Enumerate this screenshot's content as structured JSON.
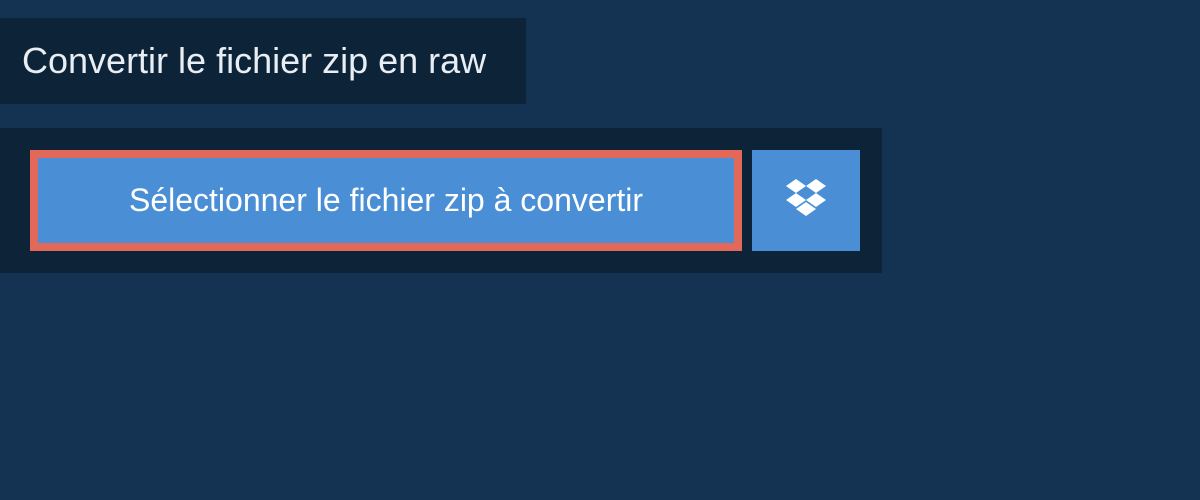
{
  "header": {
    "title": "Convertir le fichier zip en raw"
  },
  "upload": {
    "select_button_label": "Sélectionner le fichier zip à convertir",
    "dropbox_icon": "dropbox-icon"
  },
  "colors": {
    "page_bg": "#143251",
    "panel_bg": "#0d2438",
    "button_bg": "#4a8fd6",
    "highlight_border": "#e2695a",
    "text_light": "#e8eef3",
    "text_white": "#ffffff"
  }
}
